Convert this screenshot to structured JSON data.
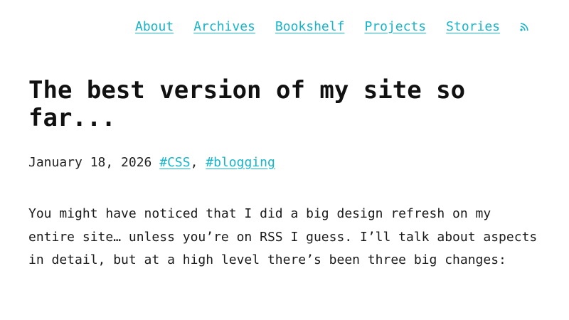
{
  "nav": {
    "items": [
      {
        "label": "About"
      },
      {
        "label": "Archives"
      },
      {
        "label": "Bookshelf"
      },
      {
        "label": "Projects"
      },
      {
        "label": "Stories"
      }
    ],
    "rss_icon": "rss-icon"
  },
  "post": {
    "title": "The best version of my site so far...",
    "date": "January 18, 2026",
    "tags": [
      "#CSS",
      "#blogging"
    ],
    "tag_separator": ",",
    "body": "You might have noticed that I did a big design refresh on my entire site… unless you’re on RSS I guess. I’ll talk about aspects in detail, but at a high level there’s been three big changes:"
  },
  "colors": {
    "link": "#16b5c9",
    "text": "#1a1a1a",
    "background": "#ffffff"
  }
}
